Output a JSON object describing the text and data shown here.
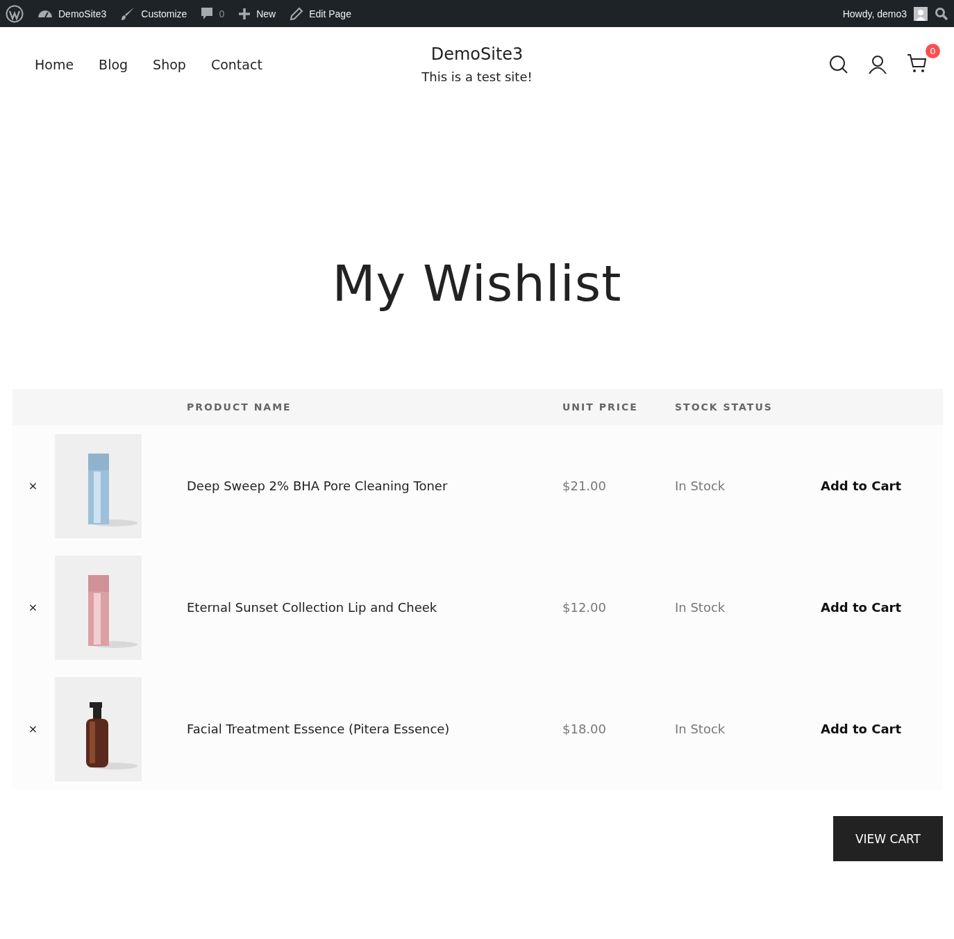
{
  "admin_bar": {
    "left": [
      {
        "kind": "wp-logo"
      },
      {
        "kind": "dashboard",
        "label": "DemoSite3"
      },
      {
        "kind": "brush",
        "label": "Customize"
      },
      {
        "kind": "comment",
        "label": "0"
      },
      {
        "kind": "plus",
        "label": "New"
      },
      {
        "kind": "pencil",
        "label": "Edit Page"
      }
    ],
    "greeting": "Howdy, demo3"
  },
  "header": {
    "nav": [
      {
        "label": "Home"
      },
      {
        "label": "Blog"
      },
      {
        "label": "Shop"
      },
      {
        "label": "Contact"
      }
    ],
    "site_title": "DemoSite3",
    "tagline": "This is a test site!",
    "cart_count": "0"
  },
  "page_title": "My Wishlist",
  "table": {
    "columns": [
      "PRODUCT NAME",
      "UNIT PRICE",
      "STOCK STATUS"
    ],
    "rows": [
      {
        "remove": "×",
        "name": "Deep Sweep 2% BHA Pore Cleaning Toner",
        "price": "$21.00",
        "stock": "In Stock",
        "action": "Add to Cart"
      },
      {
        "remove": "×",
        "name": "Eternal Sunset Collection Lip and Cheek",
        "price": "$12.00",
        "stock": "In Stock",
        "action": "Add to Cart"
      },
      {
        "remove": "×",
        "name": "Facial Treatment Essence (Pitera Essence)",
        "price": "$18.00",
        "stock": "In Stock",
        "action": "Add to Cart"
      }
    ]
  },
  "view_cart": "VIEW CART"
}
